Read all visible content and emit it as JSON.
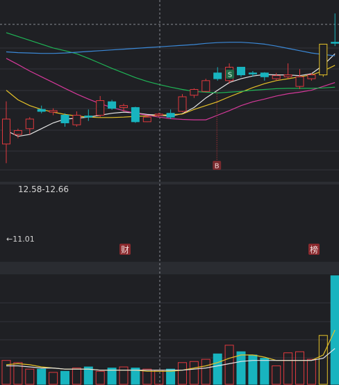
{
  "chart_data": [
    {
      "type": "candlestick",
      "title": "",
      "xlabel": "",
      "ylabel": "",
      "grid": true,
      "candles": [
        {
          "open": 12.2,
          "close": 11.55,
          "high": 12.66,
          "low": 11.05,
          "color": "red"
        },
        {
          "open": 11.8,
          "close": 11.9,
          "high": 11.95,
          "low": 11.7,
          "color": "red"
        },
        {
          "open": 11.95,
          "close": 12.2,
          "high": 12.25,
          "low": 11.8,
          "color": "red"
        },
        {
          "open": 12.45,
          "close": 12.4,
          "high": 12.55,
          "low": 12.35,
          "color": "cyan"
        },
        {
          "open": 12.38,
          "close": 12.42,
          "high": 12.48,
          "low": 12.3,
          "color": "red"
        },
        {
          "open": 12.3,
          "close": 12.1,
          "high": 12.35,
          "low": 12.0,
          "color": "cyan"
        },
        {
          "open": 12.05,
          "close": 12.3,
          "high": 12.4,
          "low": 12.0,
          "color": "red"
        },
        {
          "open": 12.25,
          "close": 12.28,
          "high": 12.45,
          "low": 12.15,
          "color": "cyan"
        },
        {
          "open": 12.3,
          "close": 12.68,
          "high": 12.8,
          "low": 12.25,
          "color": "red"
        },
        {
          "open": 12.65,
          "close": 12.48,
          "high": 12.7,
          "low": 12.44,
          "color": "cyan"
        },
        {
          "open": 12.5,
          "close": 12.55,
          "high": 12.6,
          "low": 12.4,
          "color": "red"
        },
        {
          "open": 12.5,
          "close": 12.13,
          "high": 12.52,
          "low": 12.1,
          "color": "cyan"
        },
        {
          "open": 12.13,
          "close": 12.25,
          "high": 12.3,
          "low": 12.12,
          "color": "red"
        },
        {
          "open": 12.3,
          "close": 12.33,
          "high": 12.36,
          "low": 12.25,
          "color": "red"
        },
        {
          "open": 12.35,
          "close": 12.25,
          "high": 12.45,
          "low": 12.2,
          "color": "cyan"
        },
        {
          "open": 12.4,
          "close": 12.78,
          "high": 12.85,
          "low": 12.38,
          "color": "red"
        },
        {
          "open": 12.82,
          "close": 12.97,
          "high": 13.0,
          "low": 12.75,
          "color": "red"
        },
        {
          "open": 12.92,
          "close": 13.2,
          "high": 13.25,
          "low": 12.9,
          "color": "red"
        },
        {
          "open": 13.25,
          "close": 13.4,
          "high": 13.55,
          "low": 13.2,
          "color": "cyan"
        },
        {
          "open": 13.2,
          "close": 13.55,
          "high": 13.65,
          "low": 13.12,
          "color": "red"
        },
        {
          "open": 13.55,
          "close": 13.35,
          "high": 13.55,
          "low": 13.3,
          "color": "cyan"
        },
        {
          "open": 13.38,
          "close": 13.4,
          "high": 13.45,
          "low": 13.3,
          "color": "cyan"
        },
        {
          "open": 13.4,
          "close": 13.3,
          "high": 13.42,
          "low": 13.2,
          "color": "cyan"
        },
        {
          "open": 13.25,
          "close": 13.33,
          "high": 13.4,
          "low": 13.2,
          "color": "red"
        },
        {
          "open": 13.3,
          "close": 13.35,
          "high": 13.65,
          "low": 13.25,
          "color": "red"
        },
        {
          "open": 13.05,
          "close": 13.3,
          "high": 13.5,
          "low": 12.98,
          "color": "red"
        },
        {
          "open": 13.25,
          "close": 13.35,
          "high": 13.4,
          "low": 13.2,
          "color": "red"
        },
        {
          "open": 13.35,
          "close": 14.15,
          "high": 14.15,
          "low": 13.3,
          "color": "yellow"
        },
        {
          "open": 14.2,
          "close": 14.2,
          "high": 14.95,
          "low": 14.1,
          "color": "cyan"
        }
      ],
      "moving_averages": [
        {
          "color": "#e6e6e6",
          "values": [
            11.9,
            11.75,
            11.8,
            11.95,
            12.1,
            12.2,
            12.22,
            12.25,
            12.3,
            12.35,
            12.38,
            12.36,
            12.32,
            12.3,
            12.28,
            12.34,
            12.5,
            12.75,
            12.95,
            13.15,
            13.25,
            13.32,
            13.36,
            13.35,
            13.35,
            13.33,
            13.38,
            13.6,
            13.9
          ]
        },
        {
          "color": "#e6c229",
          "values": [
            12.95,
            12.7,
            12.55,
            12.45,
            12.38,
            12.32,
            12.28,
            12.25,
            12.24,
            12.24,
            12.25,
            12.27,
            12.28,
            12.3,
            12.31,
            12.33,
            12.45,
            12.55,
            12.65,
            12.78,
            12.9,
            13.02,
            13.12,
            13.2,
            13.25,
            13.3,
            13.35,
            13.45,
            13.6
          ]
        },
        {
          "color": "#d5399a",
          "values": [
            13.78,
            13.62,
            13.45,
            13.3,
            13.15,
            13.0,
            12.85,
            12.72,
            12.6,
            12.5,
            12.42,
            12.35,
            12.3,
            12.25,
            12.21,
            12.19,
            12.18,
            12.18,
            12.3,
            12.42,
            12.55,
            12.65,
            12.72,
            12.8,
            12.86,
            12.9,
            12.95,
            13.05,
            13.15
          ]
        },
        {
          "color": "#1fb556",
          "values": [
            14.45,
            14.35,
            14.25,
            14.15,
            14.05,
            13.98,
            13.9,
            13.78,
            13.65,
            13.52,
            13.4,
            13.28,
            13.18,
            13.1,
            13.03,
            12.97,
            12.92,
            12.9,
            12.88,
            12.9,
            12.92,
            12.95,
            12.97,
            12.99,
            13.0,
            13.0,
            13.0,
            13.01,
            13.03
          ]
        },
        {
          "color": "#3b89d8",
          "values": [
            13.95,
            13.93,
            13.92,
            13.91,
            13.91,
            13.92,
            13.94,
            13.96,
            13.98,
            14.0,
            14.02,
            14.04,
            14.06,
            14.08,
            14.1,
            14.12,
            14.14,
            14.17,
            14.19,
            14.2,
            14.2,
            14.18,
            14.15,
            14.1,
            14.04,
            13.98,
            13.92,
            13.88,
            13.85
          ]
        }
      ],
      "annotations": {
        "price_range": "12.58-12.66",
        "low_marker": "←11.01",
        "buy_marker": "B",
        "sell_marker": "S",
        "event_marker_1": "财",
        "event_marker_2": "榜"
      }
    },
    {
      "type": "bar",
      "title": "",
      "xlabel": "",
      "ylabel": "",
      "grid": true,
      "values": [
        22,
        20,
        14,
        14,
        11,
        12,
        15,
        16,
        12,
        15,
        16,
        15,
        14,
        13,
        14,
        20,
        21,
        23,
        28,
        36,
        30,
        27,
        24,
        17,
        29,
        30,
        23,
        45,
        100
      ],
      "colors": [
        "red",
        "red",
        "red",
        "cyan",
        "red",
        "cyan",
        "red",
        "cyan",
        "red",
        "cyan",
        "red",
        "cyan",
        "red",
        "red",
        "cyan",
        "red",
        "red",
        "red",
        "cyan",
        "red",
        "cyan",
        "cyan",
        "cyan",
        "red",
        "red",
        "red",
        "red",
        "yellow",
        "cyan"
      ],
      "moving_averages": [
        {
          "color": "#e6c229",
          "values": [
            18,
            19,
            18,
            16,
            15,
            14,
            14,
            14,
            13,
            13,
            13,
            13,
            12,
            12,
            12,
            13,
            15,
            17,
            20,
            24,
            27,
            27,
            25,
            22,
            22,
            22,
            22,
            27,
            50
          ]
        },
        {
          "color": "#e6e6e6",
          "values": [
            17,
            17,
            16,
            15,
            15,
            14,
            14,
            14,
            13,
            13,
            13,
            13,
            13,
            13,
            13,
            13,
            14,
            15,
            17,
            19,
            21,
            22,
            22,
            22,
            22,
            22,
            22,
            24,
            33
          ]
        }
      ]
    }
  ]
}
